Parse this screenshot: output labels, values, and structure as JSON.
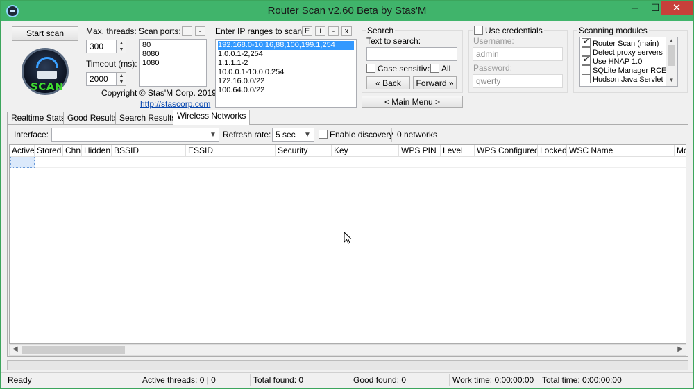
{
  "window": {
    "title": "Router Scan v2.60 Beta by Stas'M",
    "min": "─",
    "max": "☐",
    "close": "✕"
  },
  "controls": {
    "start_scan": "Start scan",
    "max_threads_label": "Max. threads:",
    "max_threads_value": "300",
    "timeout_label": "Timeout (ms):",
    "timeout_value": "2000",
    "scan_ports_label": "Scan ports:",
    "ports_add": "+",
    "ports_remove": "-",
    "ports": [
      "80",
      "8080",
      "1080"
    ],
    "logo_text": "SCAN",
    "copyright": "Copyright © Stas'M Corp. 2019",
    "link": "http://stascorp.com"
  },
  "ip_ranges": {
    "label": "Enter IP ranges to scan:",
    "buttons": [
      "E",
      "+",
      "-",
      "x"
    ],
    "items": [
      "192.168.0-10,16,88,100,199.1,254",
      "1.0.0.1-2,254",
      "1.1.1.1-2",
      "10.0.0.1-10.0.0.254",
      "172.16.0.0/22",
      "100.64.0.0/22"
    ]
  },
  "search": {
    "title": "Search",
    "text_label": "Text to search:",
    "text_value": "",
    "case_sensitive": "Case sensitive",
    "all": "All",
    "back": "« Back",
    "forward": "Forward »",
    "main_menu": "< Main Menu >"
  },
  "credentials": {
    "use_label": "Use credentials",
    "username_label": "Username:",
    "username_value": "admin",
    "password_label": "Password:",
    "password_value": "qwerty"
  },
  "modules": {
    "title": "Scanning modules",
    "items": [
      {
        "label": "Router Scan (main)",
        "checked": true
      },
      {
        "label": "Detect proxy servers",
        "checked": false
      },
      {
        "label": "Use HNAP 1.0",
        "checked": true
      },
      {
        "label": "SQLite Manager RCE",
        "checked": false
      },
      {
        "label": "Hudson Java Servlet",
        "checked": false
      }
    ]
  },
  "tabs": [
    "Realtime Stats",
    "Good Results",
    "Search Results",
    "Wireless Networks"
  ],
  "wireless": {
    "interface_label": "Interface:",
    "interface_value": "",
    "refresh_label": "Refresh rate:",
    "refresh_value": "5 sec",
    "enable_discovery": "Enable discovery",
    "networks_count": "0 networks",
    "columns": [
      "Active",
      "Stored",
      "Chn",
      "Hidden",
      "BSSID",
      "ESSID",
      "Security",
      "Key",
      "WPS PIN",
      "Level",
      "WPS",
      "Configured",
      "Locked",
      "WSC Name",
      "Mo"
    ]
  },
  "status": {
    "ready": "Ready",
    "active_threads": "Active threads: 0 | 0",
    "total_found": "Total found: 0",
    "good_found": "Good found: 0",
    "work_time": "Work time: 0:00:00:00",
    "total_time": "Total time: 0:00:00:00"
  }
}
